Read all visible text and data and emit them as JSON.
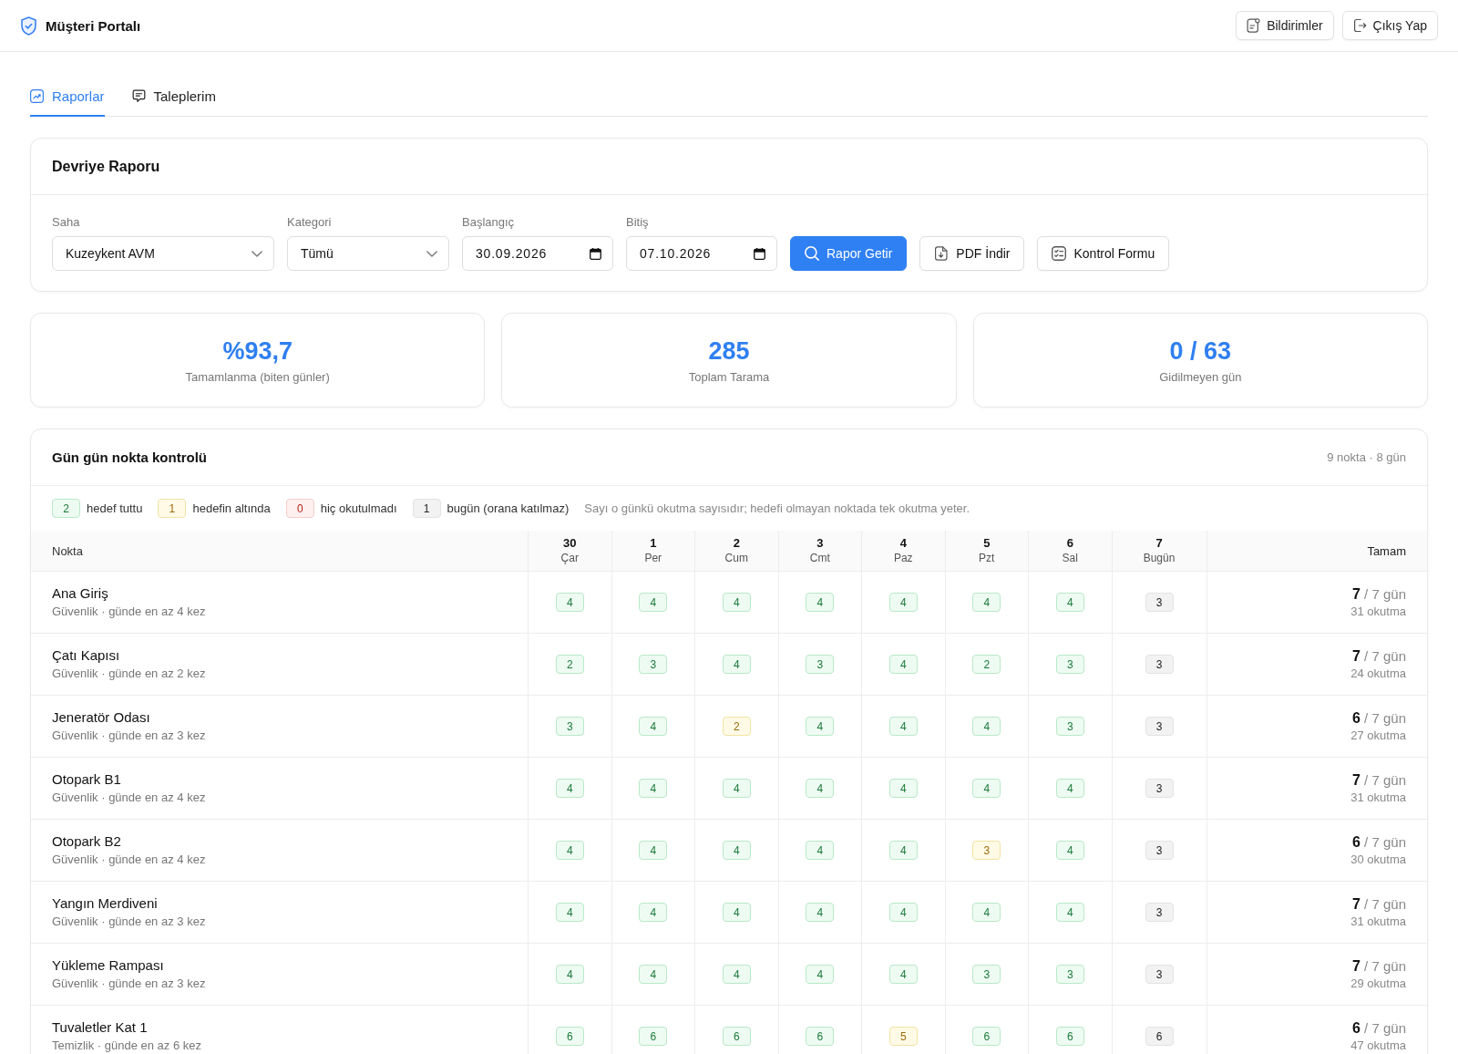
{
  "header": {
    "title": "Müşteri Portalı",
    "buttons": [
      {
        "label": "Bildirimler"
      },
      {
        "label": "Çıkış Yap"
      }
    ]
  },
  "tabs": [
    {
      "label": "Raporlar",
      "selected": true
    },
    {
      "label": "Taleplerim",
      "selected": false
    }
  ],
  "report": {
    "title": "Devriye Raporu",
    "filters": [
      {
        "label": "Saha",
        "value": "Kuzeykent AVM",
        "kind": "select"
      },
      {
        "label": "Kategori",
        "value": "Tümü",
        "kind": "select"
      },
      {
        "label": "Başlangıç",
        "value": "30.09.2026",
        "kind": "date"
      },
      {
        "label": "Bitiş",
        "value": "07.10.2026",
        "kind": "date"
      }
    ],
    "actions": [
      {
        "label": "Rapor Getir",
        "primary": true
      },
      {
        "label": "PDF İndir",
        "primary": false
      },
      {
        "label": "Kontrol Formu",
        "primary": false
      }
    ]
  },
  "stats": [
    {
      "value": "%93,7",
      "label": "Tamamlanma (biten günler)"
    },
    {
      "value": "285",
      "label": "Toplam Tarama"
    },
    {
      "value": "0 / 63",
      "label": "Gidilmeyen gün"
    }
  ],
  "daily": {
    "title": "Gün gün nokta kontrolü",
    "meta": "9 nokta · 8 gün",
    "legend": [
      {
        "value": "2",
        "label": "hedef tuttu",
        "kind": "met"
      },
      {
        "value": "1",
        "label": "hedefin altında",
        "kind": "below"
      },
      {
        "value": "0",
        "label": "hiç okutulmadı",
        "kind": "missed"
      },
      {
        "value": "1",
        "label": "bugün (orana katılmaz)",
        "kind": "today"
      }
    ],
    "note": "Sayı o günkü okutma sayısıdır; hedefi olmayan noktada tek okutma yeter.",
    "columns": {
      "point": "Nokta",
      "days": [
        {
          "day": "30",
          "weekday": "Çar"
        },
        {
          "day": "1",
          "weekday": "Per"
        },
        {
          "day": "2",
          "weekday": "Cum"
        },
        {
          "day": "3",
          "weekday": "Cmt"
        },
        {
          "day": "4",
          "weekday": "Paz"
        },
        {
          "day": "5",
          "weekday": "Pzt"
        },
        {
          "day": "6",
          "weekday": "Sal"
        },
        {
          "day": "7",
          "weekday": "Bugün"
        }
      ],
      "total": "Tamam"
    },
    "rows": [
      {
        "name": "Ana Giriş",
        "detail": "Güvenlik · günde en az 4 kez",
        "cells": [
          {
            "value": "4",
            "kind": "met"
          },
          {
            "value": "4",
            "kind": "met"
          },
          {
            "value": "4",
            "kind": "met"
          },
          {
            "value": "4",
            "kind": "met"
          },
          {
            "value": "4",
            "kind": "met"
          },
          {
            "value": "4",
            "kind": "met"
          },
          {
            "value": "4",
            "kind": "met"
          },
          {
            "value": "3",
            "kind": "today"
          }
        ],
        "done": "**7** / 7 gün",
        "scans": "31 okutma"
      },
      {
        "name": "Çatı Kapısı",
        "detail": "Güvenlik · günde en az 2 kez",
        "cells": [
          {
            "value": "2",
            "kind": "met"
          },
          {
            "value": "3",
            "kind": "met"
          },
          {
            "value": "4",
            "kind": "met"
          },
          {
            "value": "3",
            "kind": "met"
          },
          {
            "value": "4",
            "kind": "met"
          },
          {
            "value": "2",
            "kind": "met"
          },
          {
            "value": "3",
            "kind": "met"
          },
          {
            "value": "3",
            "kind": "today"
          }
        ],
        "done": "**7** / 7 gün",
        "scans": "24 okutma"
      },
      {
        "name": "Jeneratör Odası",
        "detail": "Güvenlik · günde en az 3 kez",
        "cells": [
          {
            "value": "3",
            "kind": "met"
          },
          {
            "value": "4",
            "kind": "met"
          },
          {
            "value": "2",
            "kind": "below"
          },
          {
            "value": "4",
            "kind": "met"
          },
          {
            "value": "4",
            "kind": "met"
          },
          {
            "value": "4",
            "kind": "met"
          },
          {
            "value": "3",
            "kind": "met"
          },
          {
            "value": "3",
            "kind": "today"
          }
        ],
        "done": "**6** / 7 gün",
        "scans": "27 okutma"
      },
      {
        "name": "Otopark B1",
        "detail": "Güvenlik · günde en az 4 kez",
        "cells": [
          {
            "value": "4",
            "kind": "met"
          },
          {
            "value": "4",
            "kind": "met"
          },
          {
            "value": "4",
            "kind": "met"
          },
          {
            "value": "4",
            "kind": "met"
          },
          {
            "value": "4",
            "kind": "met"
          },
          {
            "value": "4",
            "kind": "met"
          },
          {
            "value": "4",
            "kind": "met"
          },
          {
            "value": "3",
            "kind": "today"
          }
        ],
        "done": "**7** / 7 gün",
        "scans": "31 okutma"
      },
      {
        "name": "Otopark B2",
        "detail": "Güvenlik · günde en az 4 kez",
        "cells": [
          {
            "value": "4",
            "kind": "met"
          },
          {
            "value": "4",
            "kind": "met"
          },
          {
            "value": "4",
            "kind": "met"
          },
          {
            "value": "4",
            "kind": "met"
          },
          {
            "value": "4",
            "kind": "met"
          },
          {
            "value": "3",
            "kind": "below"
          },
          {
            "value": "4",
            "kind": "met"
          },
          {
            "value": "3",
            "kind": "today"
          }
        ],
        "done": "**6** / 7 gün",
        "scans": "30 okutma"
      },
      {
        "name": "Yangın Merdiveni",
        "detail": "Güvenlik · günde en az 3 kez",
        "cells": [
          {
            "value": "4",
            "kind": "met"
          },
          {
            "value": "4",
            "kind": "met"
          },
          {
            "value": "4",
            "kind": "met"
          },
          {
            "value": "4",
            "kind": "met"
          },
          {
            "value": "4",
            "kind": "met"
          },
          {
            "value": "4",
            "kind": "met"
          },
          {
            "value": "4",
            "kind": "met"
          },
          {
            "value": "3",
            "kind": "today"
          }
        ],
        "done": "**7** / 7 gün",
        "scans": "31 okutma"
      },
      {
        "name": "Yükleme Rampası",
        "detail": "Güvenlik · günde en az 3 kez",
        "cells": [
          {
            "value": "4",
            "kind": "met"
          },
          {
            "value": "4",
            "kind": "met"
          },
          {
            "value": "4",
            "kind": "met"
          },
          {
            "value": "4",
            "kind": "met"
          },
          {
            "value": "4",
            "kind": "met"
          },
          {
            "value": "3",
            "kind": "met"
          },
          {
            "value": "3",
            "kind": "met"
          },
          {
            "value": "3",
            "kind": "today"
          }
        ],
        "done": "**7** / 7 gün",
        "scans": "29 okutma"
      },
      {
        "name": "Tuvaletler Kat 1",
        "detail": "Temizlik · günde en az 6 kez",
        "cells": [
          {
            "value": "6",
            "kind": "met"
          },
          {
            "value": "6",
            "kind": "met"
          },
          {
            "value": "6",
            "kind": "met"
          },
          {
            "value": "6",
            "kind": "met"
          },
          {
            "value": "5",
            "kind": "below"
          },
          {
            "value": "6",
            "kind": "met"
          },
          {
            "value": "6",
            "kind": "met"
          },
          {
            "value": "6",
            "kind": "today"
          }
        ],
        "done": "**6** / 7 gün",
        "scans": "47 okutma"
      }
    ]
  }
}
